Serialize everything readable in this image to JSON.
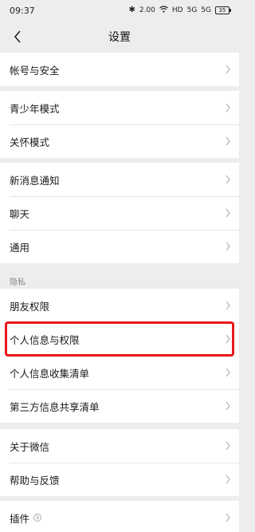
{
  "status_bar": {
    "time": "09:37",
    "bluetooth": "✱",
    "network_speed": "2.00",
    "signal_labels": [
      "HD",
      "5G",
      "5G"
    ],
    "battery": "35"
  },
  "nav": {
    "title": "设置",
    "back_icon": "chevron-left-icon"
  },
  "groups": [
    {
      "items": [
        {
          "label": "帐号与安全"
        }
      ]
    },
    {
      "items": [
        {
          "label": "青少年模式"
        },
        {
          "label": "关怀模式"
        }
      ]
    },
    {
      "items": [
        {
          "label": "新消息通知"
        },
        {
          "label": "聊天"
        },
        {
          "label": "通用"
        }
      ]
    },
    {
      "header": "隐私",
      "items": [
        {
          "label": "朋友权限"
        },
        {
          "label": "个人信息与权限",
          "highlighted": true
        },
        {
          "label": "个人信息收集清单"
        },
        {
          "label": "第三方信息共享清单"
        }
      ]
    },
    {
      "items": [
        {
          "label": "关于微信"
        },
        {
          "label": "帮助与反馈"
        }
      ]
    },
    {
      "items": [
        {
          "label": "插件",
          "badge": "9"
        }
      ]
    }
  ],
  "colors": {
    "highlight": "#e8191c",
    "background": "#ededed"
  }
}
